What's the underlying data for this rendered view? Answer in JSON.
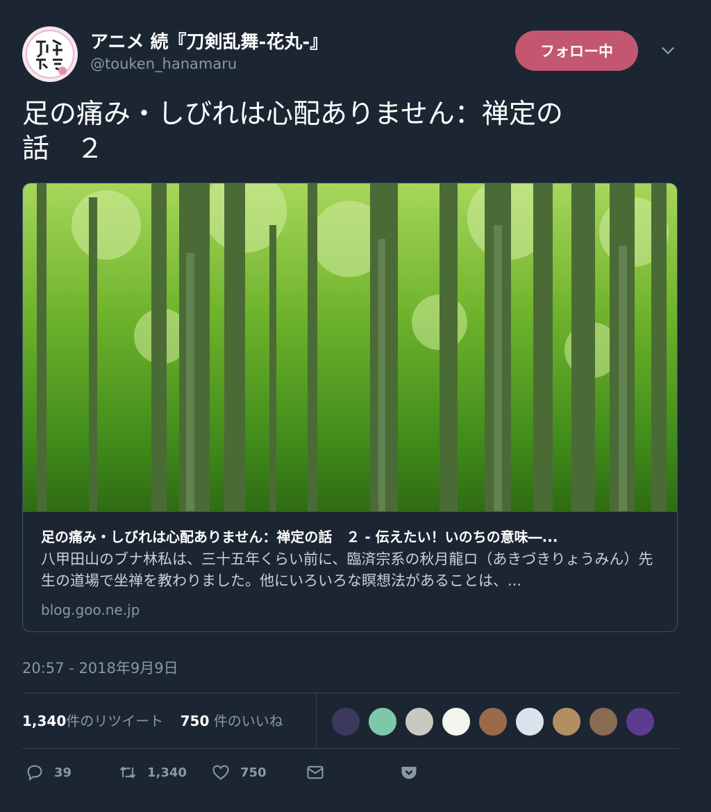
{
  "author": {
    "name": "アニメ 続『刀剣乱舞-花丸-』",
    "handle": "@touken_hanamaru",
    "follow_label": "フォロー中"
  },
  "tweet": {
    "text": "足の痛み・しびれは心配ありません：禅定の\n話　２"
  },
  "card": {
    "title": "足の痛み・しびれは心配ありません：禅定の話　２ - 伝えたい！いのちの意味―...",
    "description": "八甲田山のブナ林私は、三十五年くらい前に、臨済宗系の秋月龍ロ（あきづきりょうみん）先生の道場で坐禅を教わりました。他にいろいろな瞑想法があることは、...",
    "domain": "blog.goo.ne.jp"
  },
  "timestamp": "20:57 - 2018年9月9日",
  "stats": {
    "retweets_count": "1,340",
    "retweets_label": "件のリツイート",
    "likes_count": "750",
    "likes_label": " 件のいいね"
  },
  "actions": {
    "reply_count": "39",
    "retweet_count": "1,340",
    "like_count": "750"
  },
  "likers": [
    {
      "icon": "avatar-1",
      "color": "#3b3a5c"
    },
    {
      "icon": "avatar-2",
      "color": "#7ec8a9"
    },
    {
      "icon": "avatar-3",
      "color": "#c9c9c2"
    },
    {
      "icon": "avatar-4",
      "color": "#f5f5f0"
    },
    {
      "icon": "avatar-5",
      "color": "#9a6a4a"
    },
    {
      "icon": "avatar-6",
      "color": "#d8e4ea"
    },
    {
      "icon": "avatar-7",
      "color": "#b28e63"
    },
    {
      "icon": "avatar-8",
      "color": "#8a6b53"
    },
    {
      "icon": "avatar-9",
      "color": "#5b3c8f"
    }
  ],
  "colors": {
    "background": "#1c2532",
    "follow_button": "#c2576f",
    "muted_text": "#8899a6",
    "border": "#38444d"
  }
}
